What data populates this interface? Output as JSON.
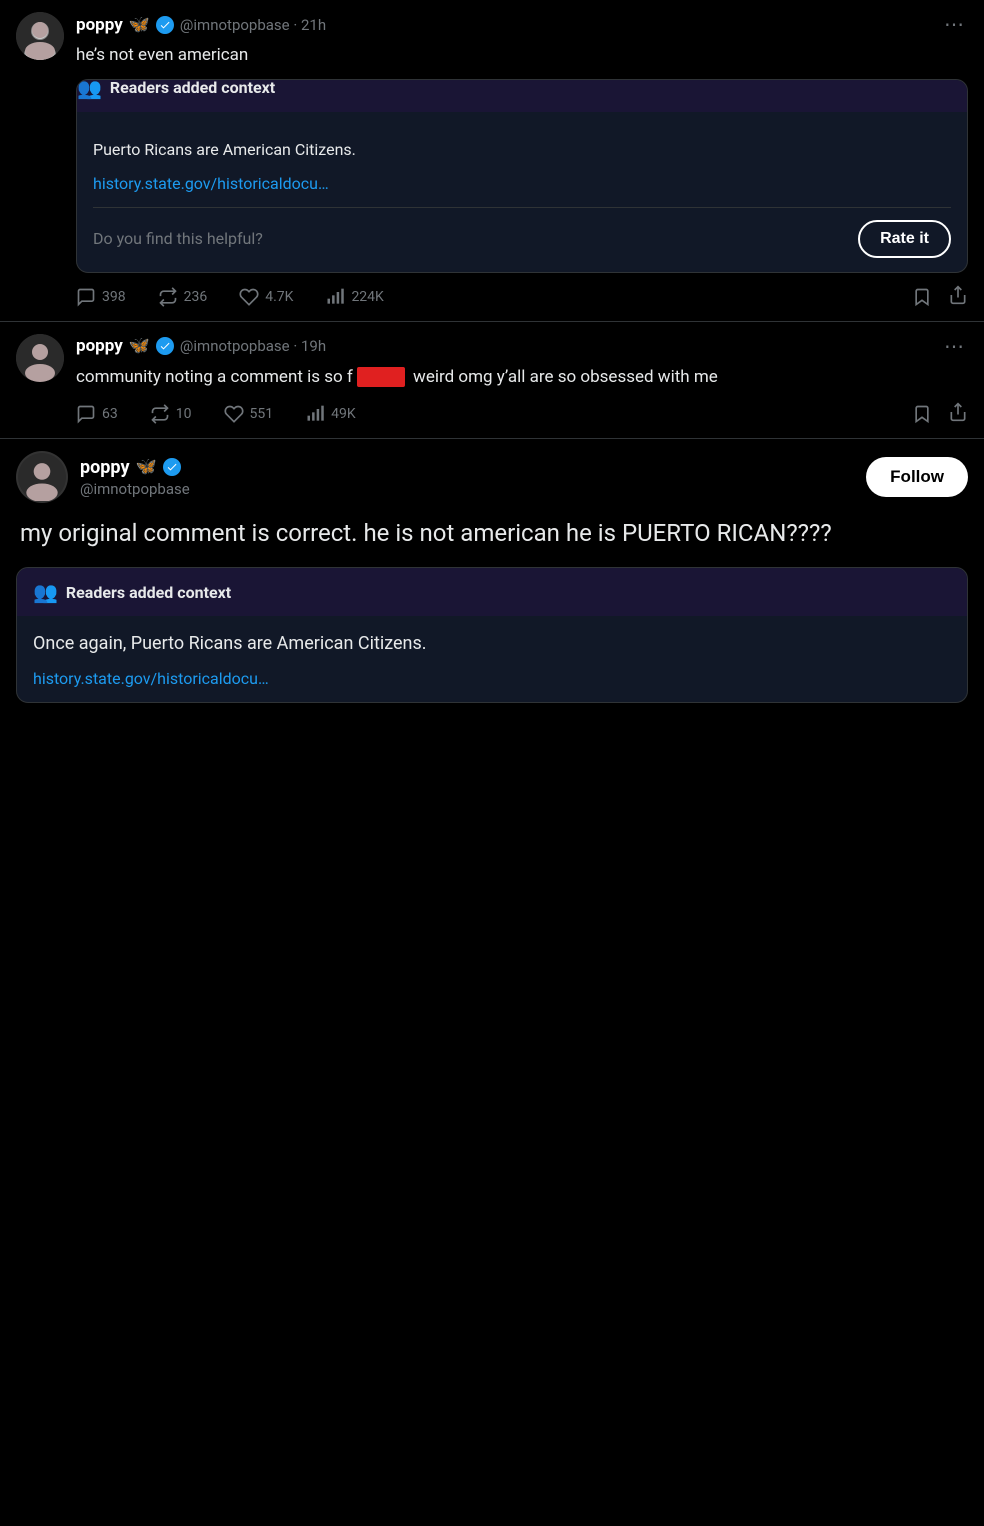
{
  "tweet1": {
    "username": "poppy",
    "handle": "@imnotpopbase",
    "time": "21h",
    "text": "he’s not even american",
    "more_icon": "⋯",
    "community_note": {
      "header": "Readers added context",
      "body": "Puerto Ricans are American Citizens.",
      "link": "history.state.gov/historicaldocu…",
      "helpful_text": "Do you find this helpful?",
      "rate_label": "Rate it"
    },
    "actions": {
      "replies": "398",
      "retweets": "236",
      "likes": "4.7K",
      "views": "224K"
    }
  },
  "tweet2": {
    "username": "poppy",
    "handle": "@imnotpopbase",
    "time": "19h",
    "text_before": "community noting a comment is so f",
    "text_after": " weird omg y’all are so obsessed with me",
    "more_icon": "⋯",
    "actions": {
      "replies": "63",
      "retweets": "10",
      "likes": "551",
      "views": "49K"
    }
  },
  "tweet3": {
    "username": "poppy",
    "handle": "@imnotpopbase",
    "follow_label": "Follow",
    "main_text": "my original comment is correct. he is not american he is PUERTO RICAN????",
    "community_note": {
      "header": "Readers added context",
      "body": "Once again, Puerto Ricans are American Citizens.",
      "link": "history.state.gov/historicaldocu…"
    }
  },
  "icons": {
    "butterfly": "🦋",
    "verified_checkmark": "✓",
    "reply": "reply",
    "retweet": "retweet",
    "like": "like",
    "views": "views",
    "bookmark": "bookmark",
    "share": "share",
    "readers": "👥"
  }
}
